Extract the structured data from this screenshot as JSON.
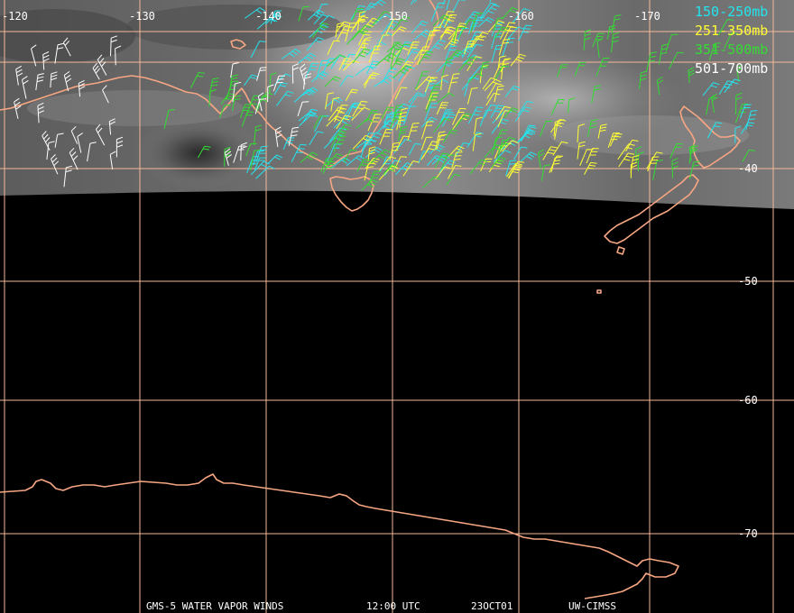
{
  "colors": {
    "grid": "#f4b99a",
    "coast": "#f7a683",
    "band_150_250": "#22e5ee",
    "band_251_350": "#ffff33",
    "band_351_500": "#33dd33",
    "band_501_700": "#ffffff"
  },
  "longitude_labels": [
    "-120",
    "-130",
    "-140",
    "-150",
    "-160",
    "-170"
  ],
  "latitude_labels": [
    "-40",
    "-50",
    "-60",
    "-70"
  ],
  "legend": [
    {
      "label": "150-250mb",
      "color": "#22e5ee"
    },
    {
      "label": "251-350mb",
      "color": "#ffff33"
    },
    {
      "label": "351-500mb",
      "color": "#33dd33"
    },
    {
      "label": "501-700mb",
      "color": "#ffffff"
    }
  ],
  "footer": {
    "satellite": "GMS-5 WATER VAPOR WINDS",
    "time": "12:00 UTC",
    "date": "23OCT01",
    "source": "UW-CIMSS"
  },
  "icons": {
    "wind_barb": "wind-barb-icon"
  }
}
